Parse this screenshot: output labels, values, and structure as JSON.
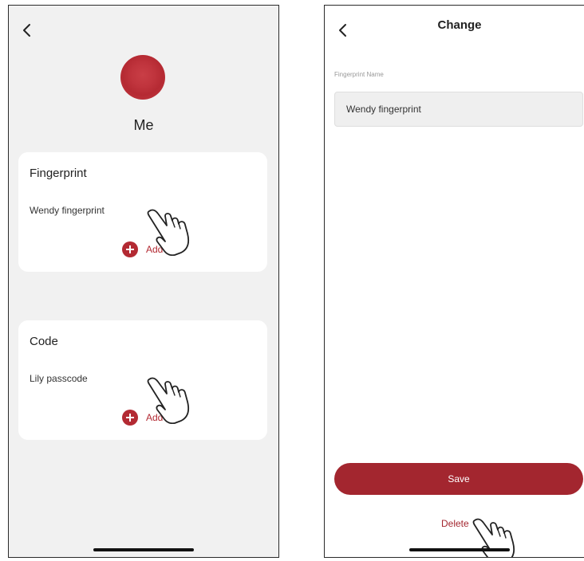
{
  "left_screen": {
    "user_name": "Me",
    "fingerprint_card": {
      "title": "Fingerprint",
      "entry": "Wendy fingerprint",
      "add_label": "Add"
    },
    "code_card": {
      "title": "Code",
      "entry": "Lily passcode",
      "add_label": "Add"
    }
  },
  "right_screen": {
    "title": "Change",
    "field_label": "Fingerprint Name",
    "field_value": "Wendy fingerprint",
    "save_label": "Save",
    "delete_label": "Delete"
  },
  "colors": {
    "accent": "#a3262f",
    "background": "#f1f1f1"
  },
  "icons": [
    "back-icon",
    "avatar",
    "add-icon",
    "hand-pointer-icon"
  ]
}
